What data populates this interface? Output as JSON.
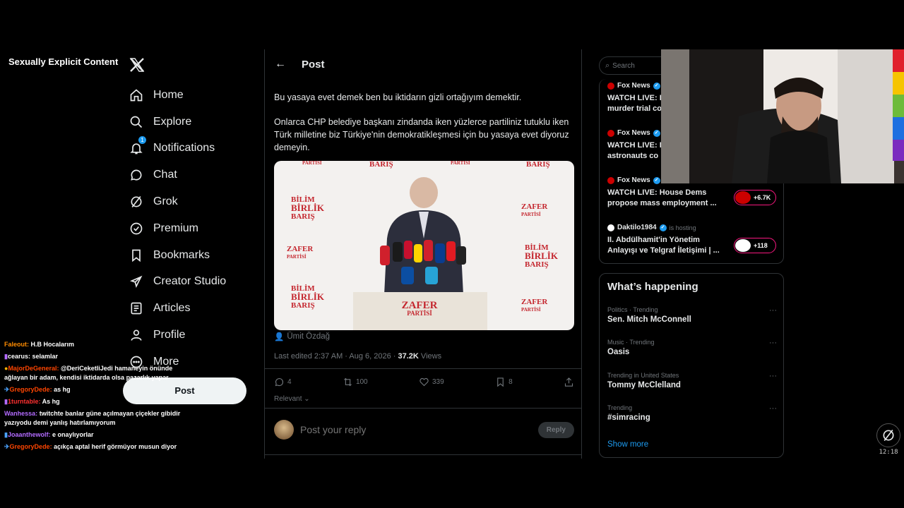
{
  "content_warning": "Sexually Explicit Content",
  "nav": {
    "items": [
      {
        "label": "Home",
        "icon": "home-icon"
      },
      {
        "label": "Explore",
        "icon": "search-icon"
      },
      {
        "label": "Notifications",
        "icon": "bell-icon",
        "badge": "1"
      },
      {
        "label": "Chat",
        "icon": "chat-icon"
      },
      {
        "label": "Grok",
        "icon": "grok-icon"
      },
      {
        "label": "Premium",
        "icon": "verified-icon"
      },
      {
        "label": "Bookmarks",
        "icon": "bookmark-icon"
      },
      {
        "label": "Creator Studio",
        "icon": "rocket-icon"
      },
      {
        "label": "Articles",
        "icon": "article-icon"
      },
      {
        "label": "Profile",
        "icon": "person-icon"
      },
      {
        "label": "More",
        "icon": "more-icon"
      }
    ],
    "post_button": "Post"
  },
  "chat": [
    {
      "user": "Faleout:",
      "color": "#ff8c00",
      "text": "H.B Hocalarım"
    },
    {
      "user": "cearus:",
      "color": "#ffffff",
      "text": "selamlar"
    },
    {
      "user": "MajorDeGeneral:",
      "color": "#ff4500",
      "text": "@DeriCeketliJedi hamaneyin önünde ağlayan bir adam, kendisi iktidarda olsa pazarlık yapar"
    },
    {
      "user": "GregoryDede:",
      "color": "#ff4500",
      "text": "as hg"
    },
    {
      "user": "1turntable:",
      "color": "#ff3030",
      "text": "As hg"
    },
    {
      "user": "Wanhessa:",
      "color": "#b36bff",
      "text": "twitchte banlar güne açılmayan çiçekler gibidir yazıyodu demi yanlış hatırlamıyorum"
    },
    {
      "user": "Joaanthewolf:",
      "color": "#b36bff",
      "text": "e onaylıyorlar"
    },
    {
      "user": "GregoryDede:",
      "color": "#ff4500",
      "text": "açıkça aptal herif görmüyor musun diyor"
    }
  ],
  "post": {
    "header": "Post",
    "text1": "Bu yasaya evet demek ben bu iktidarın gizli ortağıyım demektir.",
    "text2": "Onlarca CHP belediye başkanı zindanda iken yüzlerce partiliniz tutuklu iken Türk milletine biz Türkiye'nin demokratikleşmesi için bu yasaya evet diyoruz demeyin.",
    "image": {
      "wall_top": [
        "PARTİSİ",
        "BARIŞ",
        "PARTİSİ",
        "BARIŞ"
      ],
      "bilim": "BİLİM",
      "birlik": "BİRLİK",
      "baris": "BARIŞ",
      "zafer": "ZAFER",
      "partisi": "PARTİSİ",
      "lectern_zafer": "ZAFER",
      "lectern_partisi": "PARTİSİ"
    },
    "caption": "Ümit Özdağ",
    "meta_time": "Last edited 2:37 AM · Aug 6, 2026 · ",
    "views": "37.2K",
    "views_label": " Views",
    "replies": "4",
    "reposts": "100",
    "likes": "339",
    "bookmarks": "8",
    "sort": "Relevant",
    "reply_placeholder": "Post your reply",
    "reply_button": "Reply"
  },
  "search_placeholder": "Search",
  "live": [
    {
      "source": "Fox News",
      "title": "WATCH LIVE: I",
      "title2": "murder trial co"
    },
    {
      "source": "Fox News",
      "title": "WATCH LIVE: I",
      "title2": "astronauts co"
    },
    {
      "source": "Fox News",
      "title": "WATCH LIVE: House Dems",
      "title2": "propose mass employment ...",
      "count": "+6.7K"
    },
    {
      "source": "Daktilo1984",
      "hosting": "is hosting",
      "title": "II. Abdülhamit'in Yönetim",
      "title2": "Anlayışı ve Telgraf İletişimi | ...",
      "count": "+118"
    }
  ],
  "happening": {
    "title": "What’s happening",
    "trends": [
      {
        "category": "Politics · Trending",
        "name": "Sen. Mitch McConnell"
      },
      {
        "category": "Music · Trending",
        "name": "Oasis"
      },
      {
        "category": "Trending in United States",
        "name": "Tommy McClelland"
      },
      {
        "category": "Trending",
        "name": "#simracing"
      }
    ],
    "show_more": "Show more"
  },
  "clock": "12:18",
  "colors": {
    "accent": "#1d9bf0",
    "live_pill": "#f91880",
    "brand_red": "#c4262e"
  }
}
